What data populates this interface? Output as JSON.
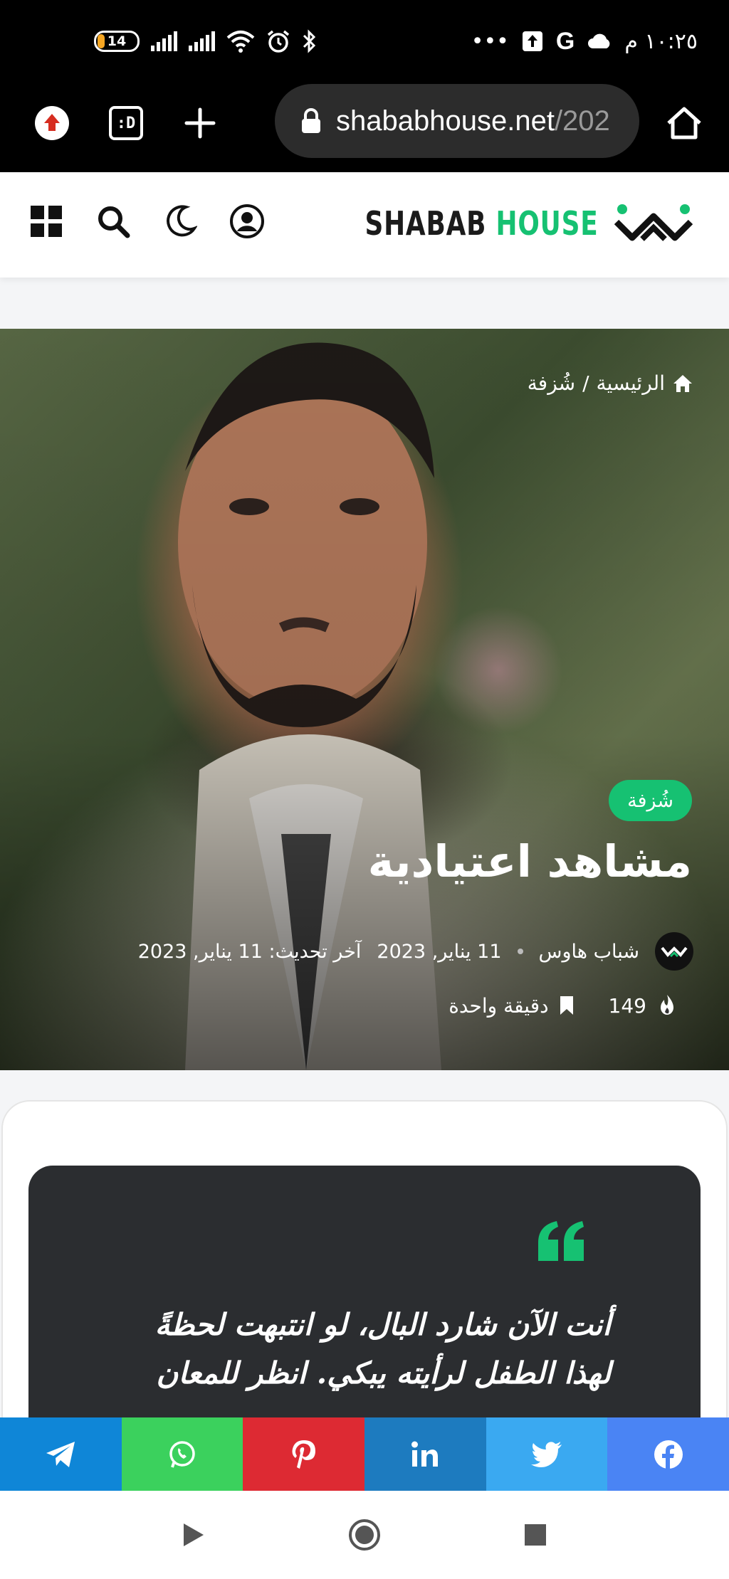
{
  "status_bar": {
    "battery_level": "14",
    "time": "١٠:٢٥ م",
    "more": "•••",
    "g_icon": "G"
  },
  "browser": {
    "url_main": "shababhouse.net",
    "url_rest": "/202",
    "tab_icon_label": ":D"
  },
  "header": {
    "logo_word1": "SHABAB",
    "logo_word2": "HOUSE",
    "icons": [
      "grid-icon",
      "search-icon",
      "moon-icon",
      "user-icon"
    ]
  },
  "hero": {
    "breadcrumb_home": "الرئيسية",
    "breadcrumb_sep": "/",
    "breadcrumb_category": "شُزفة",
    "category_badge": "شُزفة",
    "title": "مشاهد اعتيادية",
    "author": "شباب هاوس",
    "published": "11 يناير, 2023",
    "updated": "آخر تحديث: 11 يناير, 2023",
    "views": "149",
    "read_time": "دقيقة واحدة"
  },
  "article": {
    "quote": "أنت الآن شارد البال، لو انتبهت لحظةً لهذا الطفل لرأيته يبكي. انظر للمعان"
  },
  "share": {
    "buttons": [
      {
        "name": "telegram",
        "color": "#0f86d7"
      },
      {
        "name": "whatsapp",
        "color": "#3bd15d"
      },
      {
        "name": "pinterest",
        "color": "#dd2a33"
      },
      {
        "name": "linkedin",
        "color": "#1d7bbf"
      },
      {
        "name": "twitter",
        "color": "#3aa9f1"
      },
      {
        "name": "facebook",
        "color": "#4a84f4"
      }
    ]
  },
  "colors": {
    "accent": "#16c172",
    "dark": "#2b2d30"
  }
}
